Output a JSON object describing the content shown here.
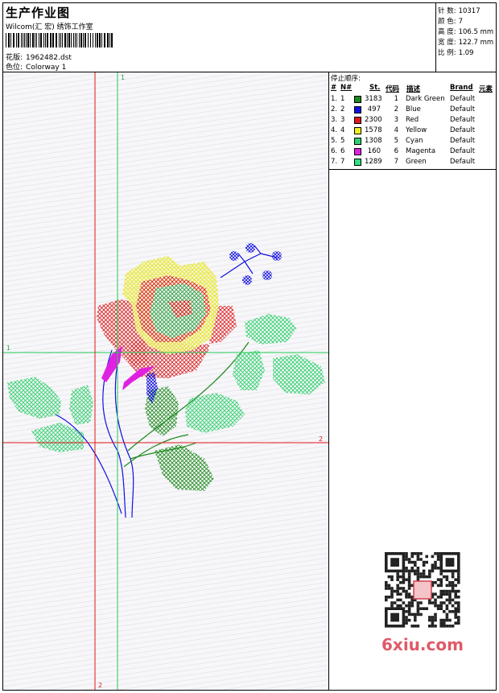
{
  "header": {
    "title": "生产作业图",
    "subtitle": "Wilcom(汇 宏) 绣饰工作室",
    "design_label": "花版:",
    "design_value": "1962482.dst",
    "colorway_label": "色位:",
    "colorway_value": "Colorway 1"
  },
  "stats": [
    {
      "label": "针 数:",
      "value": "10317"
    },
    {
      "label": "颜 色:",
      "value": "7"
    },
    {
      "label": "高 度:",
      "value": "106.5 mm"
    },
    {
      "label": "宽 度:",
      "value": "122.7 mm"
    },
    {
      "label": "比 例:",
      "value": "1.09"
    }
  ],
  "guides": {
    "v_green_top": "1",
    "h_green_left": "1",
    "h_red_right": "2",
    "v_red_bottom": "2"
  },
  "stop_sequence": {
    "title": "停止顺序:",
    "headers": {
      "num": "#",
      "n": "N#",
      "st": "St.",
      "code": "代码",
      "desc": "描述",
      "brand": "Brand",
      "element": "元素"
    },
    "rows": [
      {
        "num": "1.",
        "n": "1",
        "color": "#1a8a1a",
        "st": "3183",
        "code": "1",
        "desc": "Dark Green",
        "brand": "Default"
      },
      {
        "num": "2.",
        "n": "2",
        "color": "#1010e0",
        "st": "497",
        "code": "2",
        "desc": "Blue",
        "brand": "Default"
      },
      {
        "num": "3.",
        "n": "3",
        "color": "#e01818",
        "st": "2300",
        "code": "3",
        "desc": "Red",
        "brand": "Default"
      },
      {
        "num": "4.",
        "n": "4",
        "color": "#f0f020",
        "st": "1578",
        "code": "4",
        "desc": "Yellow",
        "brand": "Default"
      },
      {
        "num": "5.",
        "n": "5",
        "color": "#30d070",
        "st": "1308",
        "code": "5",
        "desc": "Cyan",
        "brand": "Default"
      },
      {
        "num": "6.",
        "n": "6",
        "color": "#e020e0",
        "st": "160",
        "code": "6",
        "desc": "Magenta",
        "brand": "Default"
      },
      {
        "num": "7.",
        "n": "7",
        "color": "#30e080",
        "st": "1289",
        "code": "7",
        "desc": "Green",
        "brand": "Default"
      }
    ]
  },
  "watermark": {
    "site": "6xiu.com"
  }
}
